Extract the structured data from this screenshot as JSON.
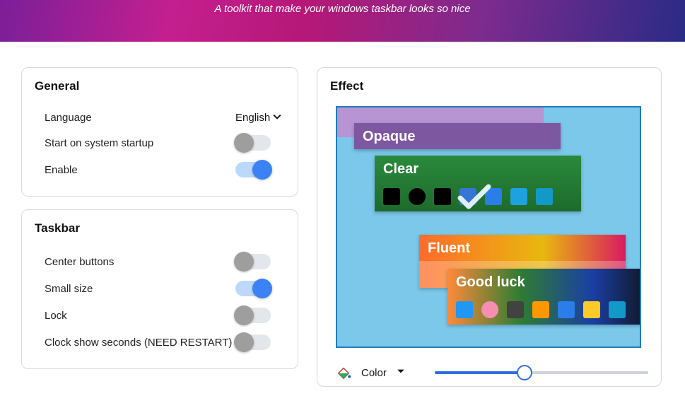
{
  "banner": {
    "tagline": "A toolkit that make your windows taskbar looks so nice"
  },
  "general": {
    "title": "General",
    "language_label": "Language",
    "language_value": "English",
    "startup_label": "Start on system startup",
    "startup_on": false,
    "enable_label": "Enable",
    "enable_on": true
  },
  "taskbar": {
    "title": "Taskbar",
    "center_label": "Center buttons",
    "center_on": false,
    "small_label": "Small size",
    "small_on": true,
    "lock_label": "Lock",
    "lock_on": false,
    "clock_seconds_label": "Clock show seconds (NEED RESTART)",
    "clock_seconds_on": false
  },
  "effect": {
    "title": "Effect",
    "options": {
      "opaque": "Opaque",
      "clear": "Clear",
      "fluent": "Fluent",
      "goodluck": "Good luck"
    },
    "selected": "clear",
    "color_label": "Color",
    "slider_value": 42,
    "slider_min": 0,
    "slider_max": 100
  }
}
